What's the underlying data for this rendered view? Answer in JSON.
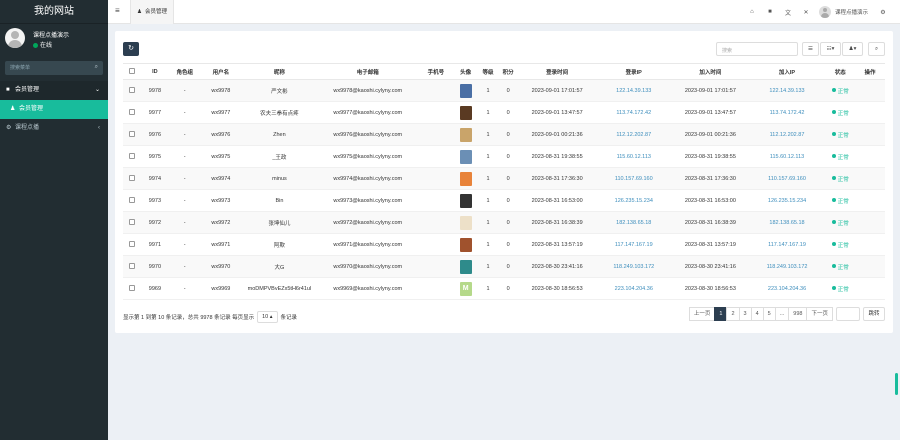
{
  "sidebar": {
    "brand": "我的网站",
    "user_name": "课程点播演示",
    "user_status": "在线",
    "search_placeholder": "搜索菜单",
    "menu": [
      {
        "label": "会员管理",
        "icon": "■"
      },
      {
        "label": "会员管理",
        "icon": "♟"
      },
      {
        "label": "课程点播",
        "icon": "⚙"
      }
    ]
  },
  "topbar": {
    "tab_label": "会员管理",
    "user_label": "课程点播演示"
  },
  "toolbar": {
    "search_placeholder": "搜索"
  },
  "table": {
    "headers": [
      "ID",
      "角色组",
      "用户名",
      "昵称",
      "电子邮箱",
      "手机号",
      "头像",
      "等级",
      "积分",
      "登录时间",
      "登录IP",
      "加入时间",
      "加入IP",
      "状态",
      "操作"
    ],
    "rows": [
      {
        "id": "9978",
        "group": "-",
        "username": "wx9978",
        "nickname": "严文彬",
        "email": "wx9978@kaoshi.cylyny.com",
        "mobile": "",
        "avatar_color": "#4a6fa5",
        "level": "1",
        "score": "0",
        "login_time": "2023-09-01 17:01:57",
        "login_ip": "122.14.39.133",
        "join_time": "2023-09-01 17:01:57",
        "join_ip": "122.14.39.133",
        "status": "正常"
      },
      {
        "id": "9977",
        "group": "-",
        "username": "wx9977",
        "nickname": "农夫三拳有点疼",
        "email": "wx9977@kaoshi.cylyny.com",
        "mobile": "",
        "avatar_color": "#5a3a22",
        "level": "1",
        "score": "0",
        "login_time": "2023-09-01 13:47:57",
        "login_ip": "113.74.172.42",
        "join_time": "2023-09-01 13:47:57",
        "join_ip": "113.74.172.42",
        "status": "正常"
      },
      {
        "id": "9976",
        "group": "-",
        "username": "wx9976",
        "nickname": "Zhen",
        "email": "wx9976@kaoshi.cylyny.com",
        "mobile": "",
        "avatar_color": "#c9a46a",
        "level": "1",
        "score": "0",
        "login_time": "2023-09-01 00:21:36",
        "login_ip": "112.12.202.87",
        "join_time": "2023-09-01 00:21:36",
        "join_ip": "112.12.202.87",
        "status": "正常"
      },
      {
        "id": "9975",
        "group": "-",
        "username": "wx9975",
        "nickname": "_王政",
        "email": "wx9975@kaoshi.cylyny.com",
        "mobile": "",
        "avatar_color": "#6b8fb5",
        "level": "1",
        "score": "0",
        "login_time": "2023-08-31 19:38:55",
        "login_ip": "115.60.12.113",
        "join_time": "2023-08-31 19:38:55",
        "join_ip": "115.60.12.113",
        "status": "正常"
      },
      {
        "id": "9974",
        "group": "-",
        "username": "wx9974",
        "nickname": "minus",
        "email": "wx9974@kaoshi.cylyny.com",
        "mobile": "",
        "avatar_color": "#e8833a",
        "level": "1",
        "score": "0",
        "login_time": "2023-08-31 17:36:30",
        "login_ip": "110.157.69.160",
        "join_time": "2023-08-31 17:36:30",
        "join_ip": "110.157.69.160",
        "status": "正常"
      },
      {
        "id": "9973",
        "group": "-",
        "username": "wx9973",
        "nickname": "Bin",
        "email": "wx9973@kaoshi.cylyny.com",
        "mobile": "",
        "avatar_color": "#333333",
        "level": "1",
        "score": "0",
        "login_time": "2023-08-31 16:53:00",
        "login_ip": "126.235.15.234",
        "join_time": "2023-08-31 16:53:00",
        "join_ip": "126.235.15.234",
        "status": "正常"
      },
      {
        "id": "9972",
        "group": "-",
        "username": "wx9972",
        "nickname": "张坤仙儿",
        "email": "wx9972@kaoshi.cylyny.com",
        "mobile": "",
        "avatar_color": "#ede0c8",
        "level": "1",
        "score": "0",
        "login_time": "2023-08-31 16:38:39",
        "login_ip": "182.138.65.18",
        "join_time": "2023-08-31 16:38:39",
        "join_ip": "182.138.65.18",
        "status": "正常"
      },
      {
        "id": "9971",
        "group": "-",
        "username": "wx9971",
        "nickname": "阿欺",
        "email": "wx9971@kaoshi.cylyny.com",
        "mobile": "",
        "avatar_color": "#a0522d",
        "level": "1",
        "score": "0",
        "login_time": "2023-08-31 13:57:19",
        "login_ip": "117.147.167.19",
        "join_time": "2023-08-31 13:57:19",
        "join_ip": "117.147.167.19",
        "status": "正常"
      },
      {
        "id": "9970",
        "group": "-",
        "username": "wx9970",
        "nickname": "大G",
        "email": "wx9970@kaoshi.cylyny.com",
        "mobile": "",
        "avatar_color": "#2e8b8b",
        "level": "1",
        "score": "0",
        "login_time": "2023-08-30 23:41:16",
        "login_ip": "118.249.103.172",
        "join_time": "2023-08-30 23:41:16",
        "join_ip": "118.249.103.172",
        "status": "正常"
      },
      {
        "id": "9969",
        "group": "-",
        "username": "wx9969",
        "nickname": "moDMPVBvEZx5tH6r41ul",
        "email": "wx9969@kaoshi.cylyny.com",
        "mobile": "",
        "avatar_color": "#b5d98a",
        "avatar_letter": "M",
        "level": "1",
        "score": "0",
        "login_time": "2023-08-30 18:56:53",
        "login_ip": "223.104.204.36",
        "join_time": "2023-08-30 18:56:53",
        "join_ip": "223.104.204.36",
        "status": "正常"
      }
    ]
  },
  "footer": {
    "info_prefix": "显示第 1 到第 10 条记录，总共 9978 条记录 每页显示",
    "page_size": "10 ▴",
    "info_suffix": "条记录",
    "pages": [
      "上一页",
      "1",
      "2",
      "3",
      "4",
      "5",
      "...",
      "998",
      "下一页"
    ],
    "active_page": "1",
    "jump_label": "跳转"
  },
  "colors": {
    "sidebar_bg": "#222d32",
    "accent": "#18bc9c",
    "primary": "#2c3e50",
    "link": "#3c8dbc"
  }
}
